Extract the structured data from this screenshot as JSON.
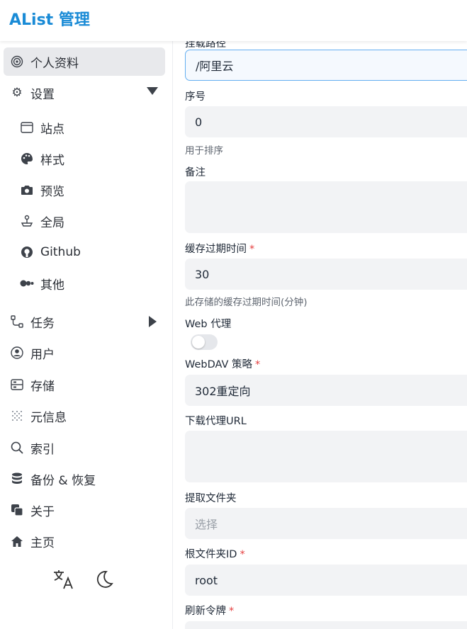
{
  "app": {
    "title": "AList 管理"
  },
  "sidebar": {
    "items": [
      {
        "label": "个人资料",
        "icon": "fingerprint-icon"
      },
      {
        "label": "设置",
        "icon": "gear-icon"
      },
      {
        "label": "站点",
        "icon": "window-icon"
      },
      {
        "label": "样式",
        "icon": "palette-icon"
      },
      {
        "label": "预览",
        "icon": "camera-icon"
      },
      {
        "label": "全局",
        "icon": "joystick-icon"
      },
      {
        "label": "Github",
        "icon": "github-icon"
      },
      {
        "label": "其他",
        "icon": "dots-icon"
      },
      {
        "label": "任务",
        "icon": "workflow-icon"
      },
      {
        "label": "用户",
        "icon": "user-circle-icon"
      },
      {
        "label": "存储",
        "icon": "database-icon"
      },
      {
        "label": "元信息",
        "icon": "grid-icon"
      },
      {
        "label": "索引",
        "icon": "search-icon"
      },
      {
        "label": "备份 & 恢复",
        "icon": "stack-icon"
      },
      {
        "label": "关于",
        "icon": "copy-icon"
      },
      {
        "label": "主页",
        "icon": "home-icon"
      }
    ]
  },
  "form": {
    "mount_label": "挂载路径",
    "mount_value": "/阿里云",
    "order_label": "序号",
    "order_value": "0",
    "order_help": "用于排序",
    "remark_label": "备注",
    "cache_label": "缓存过期时间",
    "cache_value": "30",
    "cache_help": "此存储的缓存过期时间(分钟)",
    "web_proxy_label": "Web 代理",
    "webdav_label": "WebDAV 策略",
    "webdav_value": "302重定向",
    "download_proxy_label": "下载代理URL",
    "extract_folder_label": "提取文件夹",
    "extract_folder_placeholder": "选择",
    "root_id_label": "根文件夹ID",
    "root_id_value": "root",
    "refresh_token_label": "刷新令牌",
    "required_mark": "*"
  },
  "colors": {
    "accent": "#1a8bd6",
    "required": "#e53e3e"
  }
}
